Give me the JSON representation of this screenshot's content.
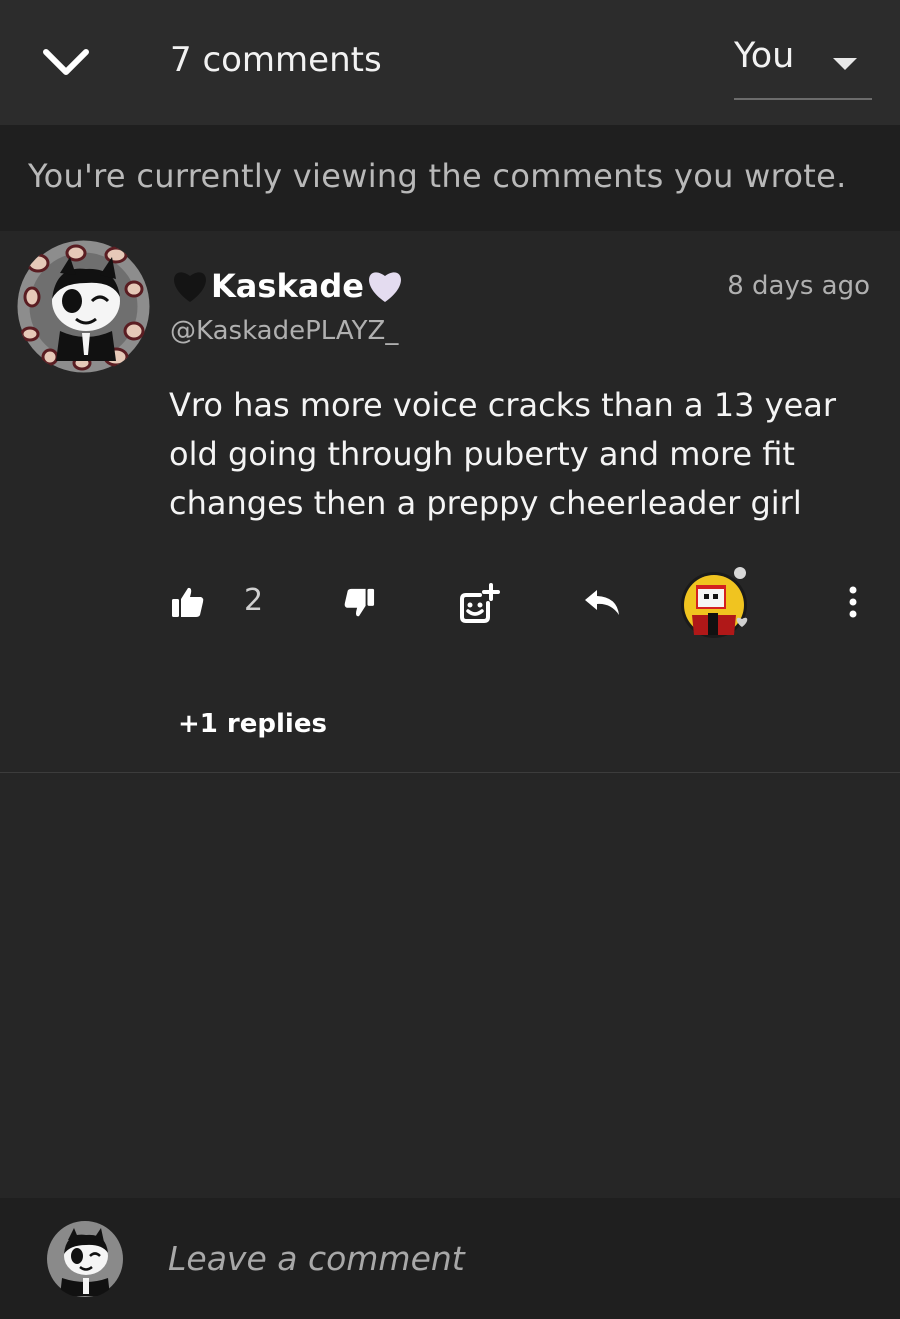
{
  "header": {
    "comment_count_label": "7 comments",
    "filter_selected": "You"
  },
  "notice": {
    "text": "You're currently viewing the comments you wrote."
  },
  "comment": {
    "display_name": "Kaskade",
    "handle": "@KaskadePLAYZ_",
    "timestamp": "8 days ago",
    "body": "Vro has more voice cracks than a 13 year old going through puberty and more fit changes then a preppy cheerleader girl",
    "like_count": "2",
    "replies_label": "+1 replies"
  },
  "composer": {
    "placeholder": "Leave a comment"
  },
  "icons": {
    "collapse": "chevron-down-icon",
    "filter_caret": "caret-down-icon",
    "like": "thumbs-up-icon",
    "dislike": "thumbs-down-icon",
    "emoji": "add-emoji-icon",
    "reply": "reply-icon",
    "more": "more-vertical-icon"
  },
  "colors": {
    "background": "#262626",
    "header": "#2c2c2c",
    "notice_bar": "#1f1f1f",
    "primary_text": "#ffffff",
    "secondary_text": "#b0b0b0"
  }
}
